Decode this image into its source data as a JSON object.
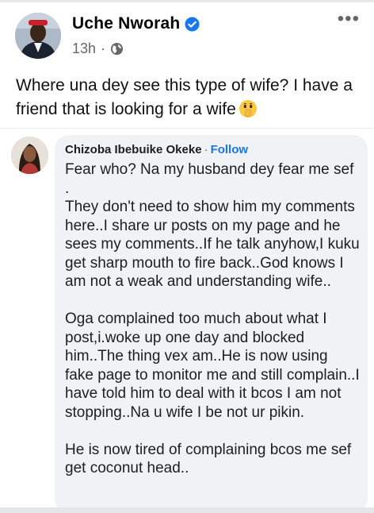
{
  "post": {
    "author": "Uche Nworah",
    "time": "13h",
    "dot": "·",
    "more": "•••",
    "caption": "Where una dey see this type of wife? I have a friend that is looking for a wife"
  },
  "comment": {
    "author": "Chizoba Ibebuike Okeke",
    "separator": "·",
    "follow_label": "Follow",
    "text": "Fear who? Na my husband dey fear me sef .\nThey don't need to show him my comments here..I share ur posts on my page and he sees my comments..If he talk anyhow,I kuku get sharp mouth to fire back..God knows I am not a weak and understanding wife..\n\nOga complained too much about what I post,i.woke up one day and blocked him..The thing vex am..He is now using fake page to monitor me and still complain..I have told him to deal with it bcos I am not stopping..Na u wife I be not ur pikin.\n\nHe is now tired of complaining bcos me sef get coconut head.."
  },
  "icons": {
    "verified": "verified-badge-icon",
    "globe": "globe-icon",
    "emoji": "shushing-face-emoji"
  },
  "colors": {
    "verified_blue": "#1877f2",
    "follow_blue": "#1877f2",
    "meta_gray": "#65676b",
    "bubble_gray": "#f0f2f5"
  }
}
